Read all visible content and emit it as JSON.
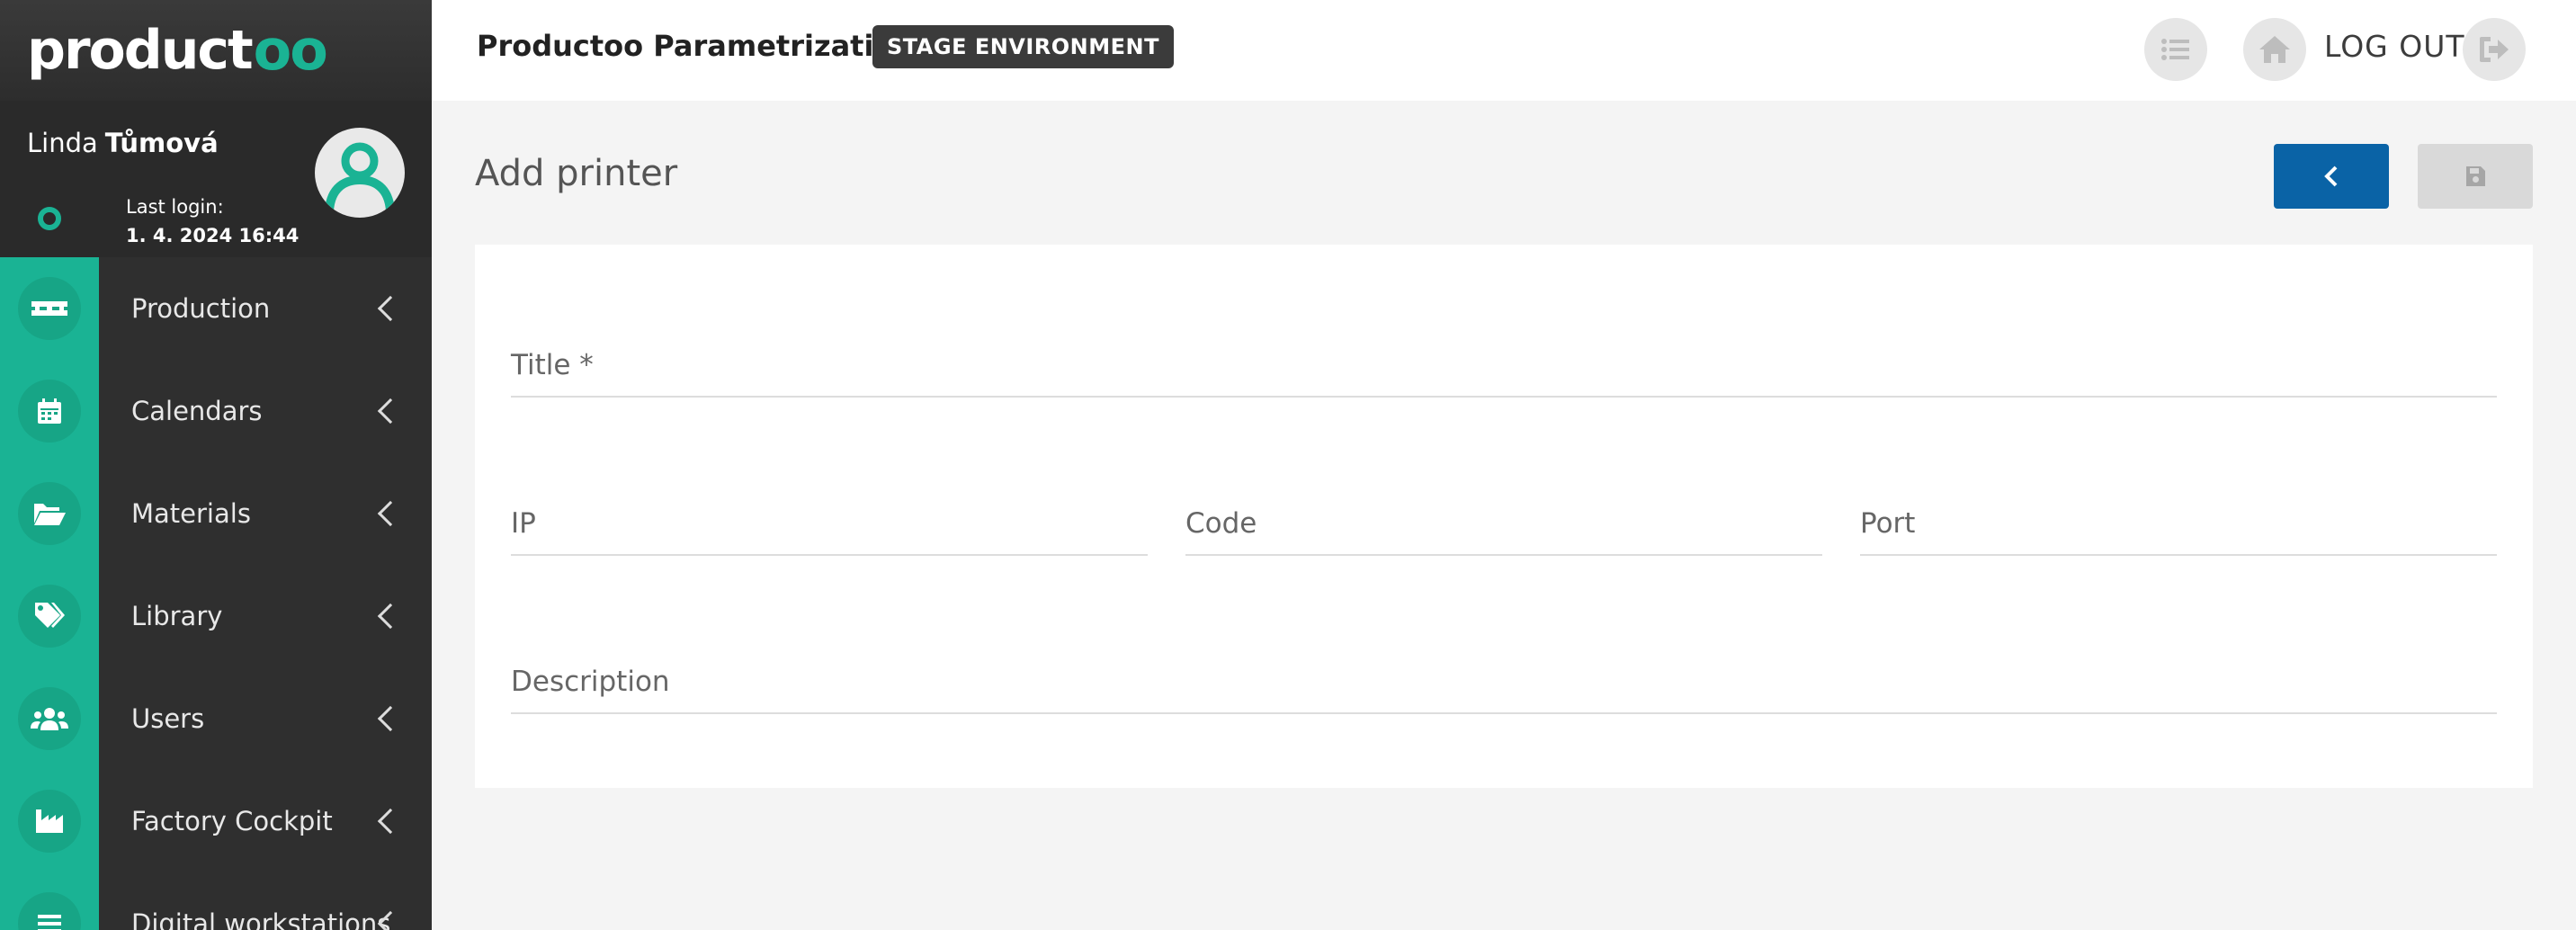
{
  "brand": {
    "name": "productoo",
    "name_main": "product",
    "name_accent": "oo"
  },
  "user": {
    "first_name": "Linda",
    "last_name": "Tůmová",
    "last_login_label": "Last login:",
    "last_login_value": "1. 4. 2024 16:44"
  },
  "menu": [
    {
      "label": "Production",
      "icon": "pallet-icon"
    },
    {
      "label": "Calendars",
      "icon": "calendar-icon"
    },
    {
      "label": "Materials",
      "icon": "folder-open-icon"
    },
    {
      "label": "Library",
      "icon": "tags-icon"
    },
    {
      "label": "Users",
      "icon": "users-icon"
    },
    {
      "label": "Factory Cockpit",
      "icon": "factory-icon"
    },
    {
      "label": "Digital workstations",
      "icon": "list-icon"
    }
  ],
  "header": {
    "title": "Productoo Parametrization",
    "env_badge": "STAGE ENVIRONMENT",
    "logout_label": "LOG OUT"
  },
  "page": {
    "title": "Add printer"
  },
  "form": {
    "title_label": "Title *",
    "ip_label": "IP",
    "code_label": "Code",
    "port_label": "Port",
    "description_label": "Description",
    "title_value": "",
    "ip_value": "",
    "code_value": "",
    "port_value": "",
    "description_value": ""
  },
  "colors": {
    "brand_green": "#1ab394",
    "primary_blue": "#0a63a6",
    "sidebar_dark": "#2f2f2f"
  }
}
